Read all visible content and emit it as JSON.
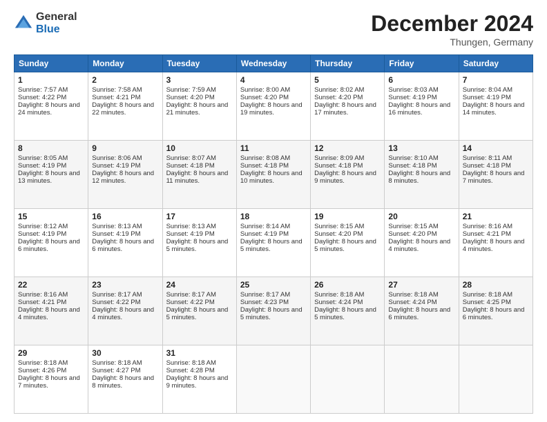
{
  "header": {
    "logo": {
      "line1": "General",
      "line2": "Blue"
    },
    "title": "December 2024",
    "location": "Thungen, Germany"
  },
  "weekdays": [
    "Sunday",
    "Monday",
    "Tuesday",
    "Wednesday",
    "Thursday",
    "Friday",
    "Saturday"
  ],
  "weeks": [
    [
      {
        "day": "1",
        "sunrise": "Sunrise: 7:57 AM",
        "sunset": "Sunset: 4:22 PM",
        "daylight": "Daylight: 8 hours and 24 minutes."
      },
      {
        "day": "2",
        "sunrise": "Sunrise: 7:58 AM",
        "sunset": "Sunset: 4:21 PM",
        "daylight": "Daylight: 8 hours and 22 minutes."
      },
      {
        "day": "3",
        "sunrise": "Sunrise: 7:59 AM",
        "sunset": "Sunset: 4:20 PM",
        "daylight": "Daylight: 8 hours and 21 minutes."
      },
      {
        "day": "4",
        "sunrise": "Sunrise: 8:00 AM",
        "sunset": "Sunset: 4:20 PM",
        "daylight": "Daylight: 8 hours and 19 minutes."
      },
      {
        "day": "5",
        "sunrise": "Sunrise: 8:02 AM",
        "sunset": "Sunset: 4:20 PM",
        "daylight": "Daylight: 8 hours and 17 minutes."
      },
      {
        "day": "6",
        "sunrise": "Sunrise: 8:03 AM",
        "sunset": "Sunset: 4:19 PM",
        "daylight": "Daylight: 8 hours and 16 minutes."
      },
      {
        "day": "7",
        "sunrise": "Sunrise: 8:04 AM",
        "sunset": "Sunset: 4:19 PM",
        "daylight": "Daylight: 8 hours and 14 minutes."
      }
    ],
    [
      {
        "day": "8",
        "sunrise": "Sunrise: 8:05 AM",
        "sunset": "Sunset: 4:19 PM",
        "daylight": "Daylight: 8 hours and 13 minutes."
      },
      {
        "day": "9",
        "sunrise": "Sunrise: 8:06 AM",
        "sunset": "Sunset: 4:19 PM",
        "daylight": "Daylight: 8 hours and 12 minutes."
      },
      {
        "day": "10",
        "sunrise": "Sunrise: 8:07 AM",
        "sunset": "Sunset: 4:18 PM",
        "daylight": "Daylight: 8 hours and 11 minutes."
      },
      {
        "day": "11",
        "sunrise": "Sunrise: 8:08 AM",
        "sunset": "Sunset: 4:18 PM",
        "daylight": "Daylight: 8 hours and 10 minutes."
      },
      {
        "day": "12",
        "sunrise": "Sunrise: 8:09 AM",
        "sunset": "Sunset: 4:18 PM",
        "daylight": "Daylight: 8 hours and 9 minutes."
      },
      {
        "day": "13",
        "sunrise": "Sunrise: 8:10 AM",
        "sunset": "Sunset: 4:18 PM",
        "daylight": "Daylight: 8 hours and 8 minutes."
      },
      {
        "day": "14",
        "sunrise": "Sunrise: 8:11 AM",
        "sunset": "Sunset: 4:18 PM",
        "daylight": "Daylight: 8 hours and 7 minutes."
      }
    ],
    [
      {
        "day": "15",
        "sunrise": "Sunrise: 8:12 AM",
        "sunset": "Sunset: 4:19 PM",
        "daylight": "Daylight: 8 hours and 6 minutes."
      },
      {
        "day": "16",
        "sunrise": "Sunrise: 8:13 AM",
        "sunset": "Sunset: 4:19 PM",
        "daylight": "Daylight: 8 hours and 6 minutes."
      },
      {
        "day": "17",
        "sunrise": "Sunrise: 8:13 AM",
        "sunset": "Sunset: 4:19 PM",
        "daylight": "Daylight: 8 hours and 5 minutes."
      },
      {
        "day": "18",
        "sunrise": "Sunrise: 8:14 AM",
        "sunset": "Sunset: 4:19 PM",
        "daylight": "Daylight: 8 hours and 5 minutes."
      },
      {
        "day": "19",
        "sunrise": "Sunrise: 8:15 AM",
        "sunset": "Sunset: 4:20 PM",
        "daylight": "Daylight: 8 hours and 5 minutes."
      },
      {
        "day": "20",
        "sunrise": "Sunrise: 8:15 AM",
        "sunset": "Sunset: 4:20 PM",
        "daylight": "Daylight: 8 hours and 4 minutes."
      },
      {
        "day": "21",
        "sunrise": "Sunrise: 8:16 AM",
        "sunset": "Sunset: 4:21 PM",
        "daylight": "Daylight: 8 hours and 4 minutes."
      }
    ],
    [
      {
        "day": "22",
        "sunrise": "Sunrise: 8:16 AM",
        "sunset": "Sunset: 4:21 PM",
        "daylight": "Daylight: 8 hours and 4 minutes."
      },
      {
        "day": "23",
        "sunrise": "Sunrise: 8:17 AM",
        "sunset": "Sunset: 4:22 PM",
        "daylight": "Daylight: 8 hours and 4 minutes."
      },
      {
        "day": "24",
        "sunrise": "Sunrise: 8:17 AM",
        "sunset": "Sunset: 4:22 PM",
        "daylight": "Daylight: 8 hours and 5 minutes."
      },
      {
        "day": "25",
        "sunrise": "Sunrise: 8:17 AM",
        "sunset": "Sunset: 4:23 PM",
        "daylight": "Daylight: 8 hours and 5 minutes."
      },
      {
        "day": "26",
        "sunrise": "Sunrise: 8:18 AM",
        "sunset": "Sunset: 4:24 PM",
        "daylight": "Daylight: 8 hours and 5 minutes."
      },
      {
        "day": "27",
        "sunrise": "Sunrise: 8:18 AM",
        "sunset": "Sunset: 4:24 PM",
        "daylight": "Daylight: 8 hours and 6 minutes."
      },
      {
        "day": "28",
        "sunrise": "Sunrise: 8:18 AM",
        "sunset": "Sunset: 4:25 PM",
        "daylight": "Daylight: 8 hours and 6 minutes."
      }
    ],
    [
      {
        "day": "29",
        "sunrise": "Sunrise: 8:18 AM",
        "sunset": "Sunset: 4:26 PM",
        "daylight": "Daylight: 8 hours and 7 minutes."
      },
      {
        "day": "30",
        "sunrise": "Sunrise: 8:18 AM",
        "sunset": "Sunset: 4:27 PM",
        "daylight": "Daylight: 8 hours and 8 minutes."
      },
      {
        "day": "31",
        "sunrise": "Sunrise: 8:18 AM",
        "sunset": "Sunset: 4:28 PM",
        "daylight": "Daylight: 8 hours and 9 minutes."
      },
      null,
      null,
      null,
      null
    ]
  ]
}
